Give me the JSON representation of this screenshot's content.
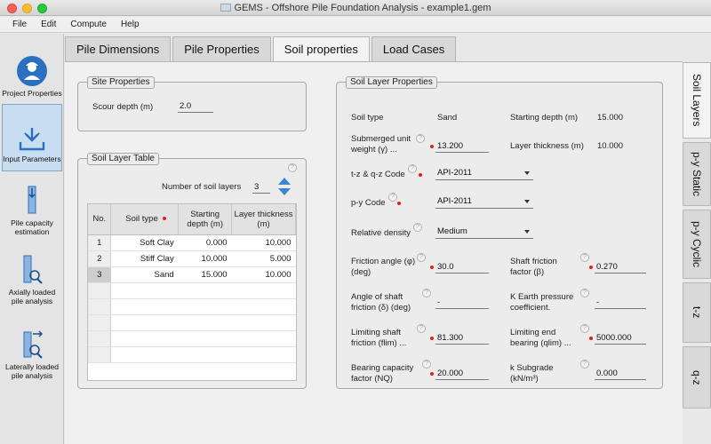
{
  "window": {
    "title": "GEMS - Offshore Pile Foundation Analysis - example1.gem"
  },
  "menu": [
    "File",
    "Edit",
    "Compute",
    "Help"
  ],
  "sidebar": {
    "items": [
      {
        "label": "Project Properties"
      },
      {
        "label": "Input Parameters"
      },
      {
        "label": "Pile capacity estimation"
      },
      {
        "label": "Axially loaded pile analysis"
      },
      {
        "label": "Laterally loaded pile analysis"
      }
    ]
  },
  "tabs": [
    "Pile Dimensions",
    "Pile Properties",
    "Soil properties",
    "Load Cases"
  ],
  "vtabs": [
    "Soil Layers",
    "p-y Static",
    "p-y Cyclic",
    "t-z",
    "q-z"
  ],
  "site": {
    "title": "Site Properties",
    "scour_label": "Scour depth  (m)",
    "scour_value": "2.0"
  },
  "table": {
    "title": "Soil Layer Table",
    "num_layers_label": "Number of soil layers",
    "num_layers_value": "3",
    "headers": {
      "no": "No.",
      "soil_type": "Soil type",
      "start_depth": "Starting depth (m)",
      "thickness": "Layer thickness (m)"
    },
    "rows": [
      {
        "no": "1",
        "soil_type": "Soft Clay",
        "start": "0.000",
        "thick": "10.000"
      },
      {
        "no": "2",
        "soil_type": "Stiff Clay",
        "start": "10.000",
        "thick": "5.000"
      },
      {
        "no": "3",
        "soil_type": "Sand",
        "start": "15.000",
        "thick": "10.000"
      }
    ]
  },
  "layer": {
    "title": "Soil Layer Properties",
    "soil_type_label": "Soil type",
    "soil_type_value": "Sand",
    "start_label": "Starting depth (m)",
    "start_value": "15.000",
    "unit_weight_label1": "Submerged unit",
    "unit_weight_label2": "weight (γ) ...",
    "unit_weight_value": "13.200",
    "thickness_label": "Layer thickness (m)",
    "thickness_value": "10.000",
    "tz_label": "t-z & q-z Code",
    "tz_value": "API-2011",
    "py_label": "p-y Code",
    "py_value": "API-2011",
    "density_label": "Relative density",
    "density_value": "Medium",
    "friction_label1": "Friction angle (φ)",
    "friction_label2": "(deg)",
    "friction_value": "30.0",
    "shaft_factor_label1": "Shaft friction",
    "shaft_factor_label2": "factor (β)",
    "shaft_factor_value": "0.270",
    "shaft_angle_label1": "Angle of shaft",
    "shaft_angle_label2": "friction (δ) (deg)",
    "shaft_angle_value": "-",
    "k_label1": "K Earth pressure",
    "k_label2": "coefficient.",
    "k_value": "-",
    "flim_label1": "Limiting shaft",
    "flim_label2": "friction (flim) ...",
    "flim_value": "81.300",
    "qlim_label1": "Limiting end",
    "qlim_label2": "bearing (qlim) ...",
    "qlim_value": "5000.000",
    "nq_label1": "Bearing capacity",
    "nq_label2": "factor (NQ)",
    "nq_value": "20.000",
    "ksub_label1": "k Subgrade",
    "ksub_label2": "(kN/m³)",
    "ksub_value": "0.000"
  },
  "help_glyph": "?",
  "colors": {
    "required": "#e02020",
    "active_side": "#c9ddf1",
    "accent_blue": "#2a6fc0"
  }
}
